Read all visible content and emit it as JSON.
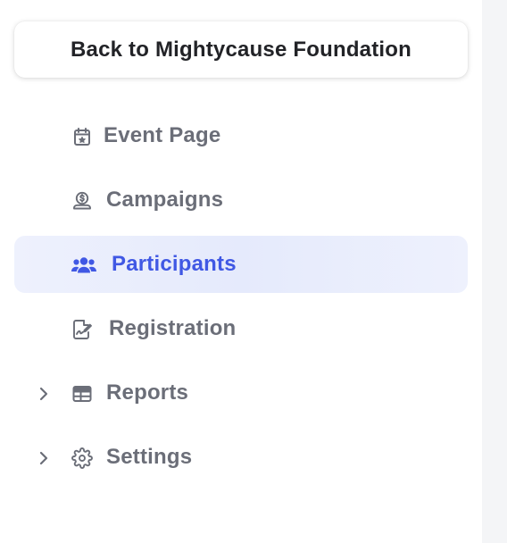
{
  "back_button": {
    "label": "Back to Mightycause Foundation"
  },
  "nav": {
    "items": [
      {
        "label": "Event Page",
        "icon": "calendar-star-icon",
        "active": false,
        "expandable": false
      },
      {
        "label": "Campaigns",
        "icon": "hand-coin-icon",
        "active": false,
        "expandable": false
      },
      {
        "label": "Participants",
        "icon": "users-icon",
        "active": true,
        "expandable": false
      },
      {
        "label": "Registration",
        "icon": "form-edit-icon",
        "active": false,
        "expandable": false
      },
      {
        "label": "Reports",
        "icon": "table-icon",
        "active": false,
        "expandable": true
      },
      {
        "label": "Settings",
        "icon": "gear-icon",
        "active": false,
        "expandable": true
      }
    ]
  },
  "colors": {
    "accent": "#4058e4",
    "active_bg": "#eef1fd",
    "text_muted": "#6b6e78",
    "text_dark": "#222327"
  }
}
